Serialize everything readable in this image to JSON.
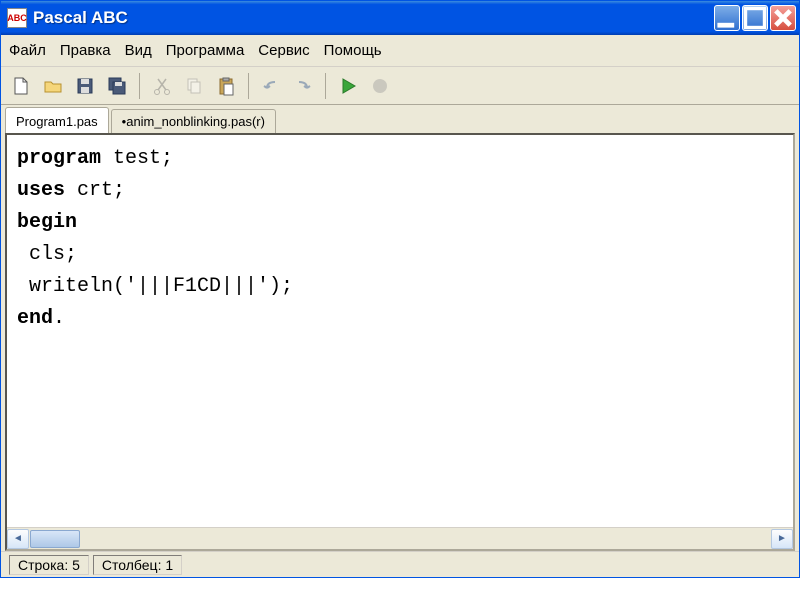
{
  "title": "Pascal ABC",
  "menu": {
    "file": "Файл",
    "edit": "Правка",
    "view": "Вид",
    "program": "Программа",
    "service": "Сервис",
    "help": "Помощь"
  },
  "tabs": {
    "active": "Program1.pas",
    "inactive": "•anim_nonblinking.pas(r)"
  },
  "code": {
    "line1_kw": "program",
    "line1_rest": " test;",
    "line2_kw": "uses",
    "line2_rest": " crt;",
    "line3_kw": "begin",
    "line4": " cls;",
    "line5": " writeln('|||F1CD|||');",
    "line6_kw": "end",
    "line6_rest": "."
  },
  "status": {
    "line_label": "Строка: ",
    "line_val": "5",
    "col_label": "Столбец: ",
    "col_val": "1"
  },
  "icons": {
    "app": "ABC"
  }
}
